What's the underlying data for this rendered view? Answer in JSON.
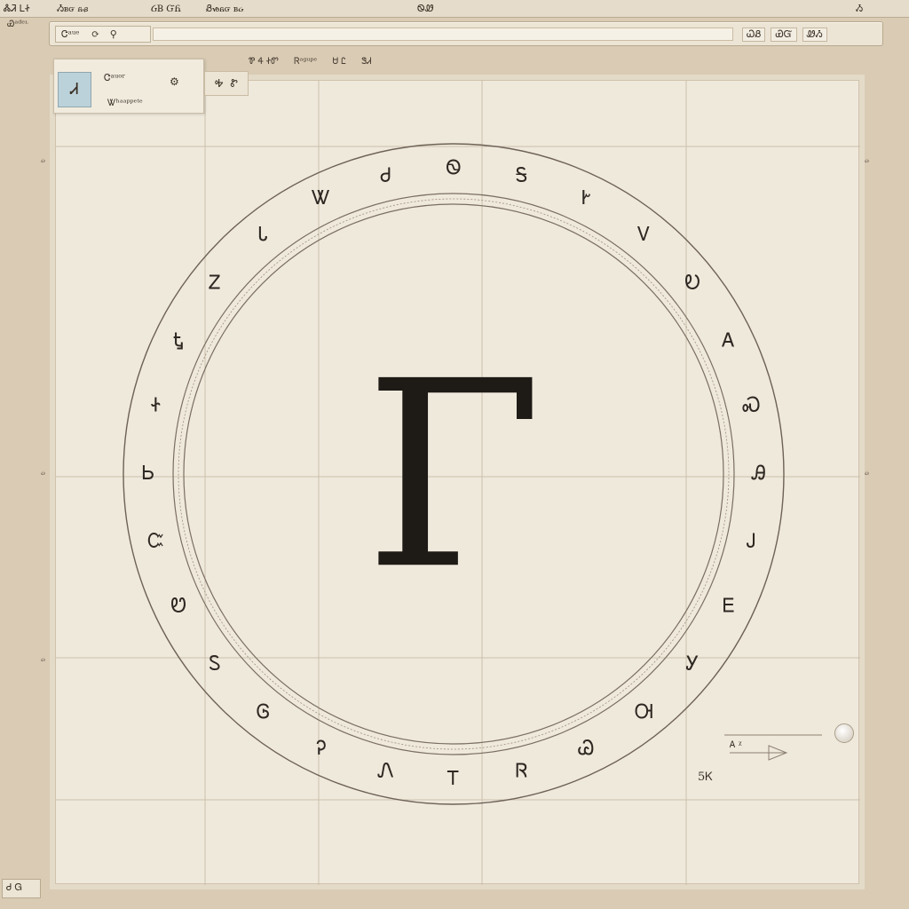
{
  "menubar": {
    "item1": "ᏜᏘ ᏞᏐ",
    "item2": "Ᏹᏼᏻ ᏺᏸ",
    "item3": "ᏵᏴ ᏳᏲ",
    "item4": "Ᏸᏹᏺᏻ ᏼᏽ",
    "item5": "ᏫᏪ",
    "item6": "Ᏹ"
  },
  "sub_left": "Ꮿᵃᵈᵉᶫ",
  "toolbar": {
    "open_label": "Ꮳᵃᵘᵉ",
    "open_icon": "refresh-icon",
    "right_buttons": [
      "ᏇᏰ",
      "ᏯᏳ",
      "ᏪᏱ"
    ]
  },
  "ribbon": {
    "items": [
      "Ꮘ Ꮞ ᏐᏛ",
      "Ꮢᵃᵍᵘᵖᵉ",
      "Ꮜ Ꮭ",
      "ᏕᏗ"
    ]
  },
  "panel": {
    "thumb_glyph": "Ꮧ",
    "title": "Ꮳᵃᵘᵒʳ",
    "subtitle": "Ꮤʰᵃᵃᵖᵖᵉᵗᵉ",
    "gear_icon": "gear-icon"
  },
  "closebox": {
    "label_a": "Ꭽ",
    "label_b": "Ꮡ"
  },
  "canvas": {
    "center_glyph": "Γ",
    "ring_labels": [
      "Ꮻ",
      "Ꭶ",
      "Ꭸ",
      "Ꮩ",
      "Ꭷ",
      "Ꭺ",
      "Ꮝ",
      "Ꭿ",
      "Ꭻ",
      "Ꭼ",
      "Ꭹ",
      "Ꮊ",
      "Ꮚ",
      "Ꮢ",
      "Ꭲ",
      "Ꮑ",
      "Ꭾ",
      "Ꮆ",
      "Ꮪ",
      "Ꮼ",
      "Ꮸ",
      "Ꮟ",
      "Ꮠ",
      "Ꮏ",
      "Ꮓ",
      "Ꮣ",
      "Ꮤ",
      "Ꮷ"
    ]
  },
  "arrow_tool": {
    "label": "Ꭺ ᵡ"
  },
  "zoom_label": "5Ꮶ",
  "side_numbers": [
    "ᏽ",
    "ᏽ",
    "ᏽ",
    "ᏽ",
    "ᏽ"
  ],
  "bottom_left": "Ꮷ Ꮐ",
  "colors": {
    "background": "#d9cbb4",
    "canvas": "#efe9dc",
    "ink": "#1e1a16"
  }
}
